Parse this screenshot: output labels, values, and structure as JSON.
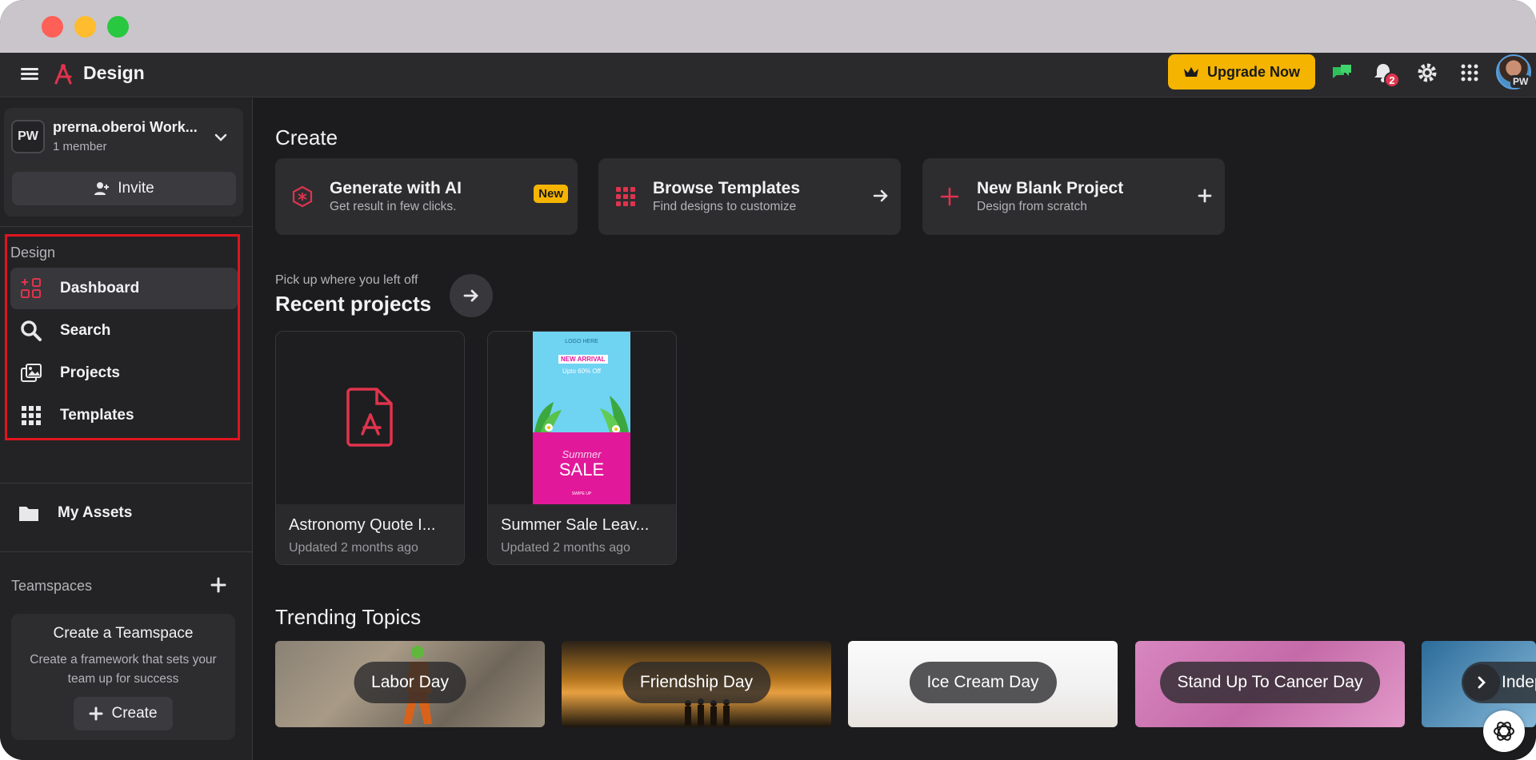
{
  "app": {
    "title": "Design"
  },
  "header": {
    "upgrade_label": "Upgrade Now",
    "notification_count": "2",
    "avatar_initials": "PW"
  },
  "workspace": {
    "initials": "PW",
    "name": "prerna.oberoi Work...",
    "members": "1 member",
    "invite_label": "Invite"
  },
  "sidebar": {
    "section_label": "Design",
    "items": [
      {
        "label": "Dashboard",
        "icon": "dashboard-icon",
        "active": true
      },
      {
        "label": "Search",
        "icon": "search-icon"
      },
      {
        "label": "Projects",
        "icon": "projects-icon"
      },
      {
        "label": "Templates",
        "icon": "grid-icon"
      },
      {
        "label": "My Assets",
        "icon": "folder-icon"
      }
    ],
    "teamspaces_label": "Teamspaces",
    "teamspace_card": {
      "title": "Create a Teamspace",
      "description": "Create a framework that sets your team up for success",
      "create_label": "Create"
    }
  },
  "main": {
    "create_heading": "Create",
    "create_cards": [
      {
        "title": "Generate with AI",
        "subtitle": "Get result in few clicks.",
        "badge": "New"
      },
      {
        "title": "Browse Templates",
        "subtitle": "Find designs to customize"
      },
      {
        "title": "New Blank Project",
        "subtitle": "Design from scratch"
      }
    ],
    "pickup_label": "Pick up where you left off",
    "recent_heading": "Recent projects",
    "projects": [
      {
        "title": "Astronomy Quote I...",
        "updated": "Updated 2 months ago"
      },
      {
        "title": "Summer Sale Leav...",
        "updated": "Updated 2 months ago"
      }
    ],
    "poster": {
      "logo_text": "LOGO HERE",
      "new_arrival": "NEW ARRIVAL",
      "upto": "Upto 60% Off",
      "summer": "Summer",
      "sale": "SALE",
      "swipe": "SWIPE UP"
    },
    "trending_heading": "Trending Topics",
    "topics": [
      {
        "label": "Labor Day"
      },
      {
        "label": "Friendship Day"
      },
      {
        "label": "Ice Cream Day"
      },
      {
        "label": "Stand Up To Cancer Day"
      },
      {
        "label": "Indep"
      }
    ]
  },
  "colors": {
    "accent": "#e0334d",
    "upgrade": "#f5b400",
    "highlight_box": "#e1141e"
  }
}
